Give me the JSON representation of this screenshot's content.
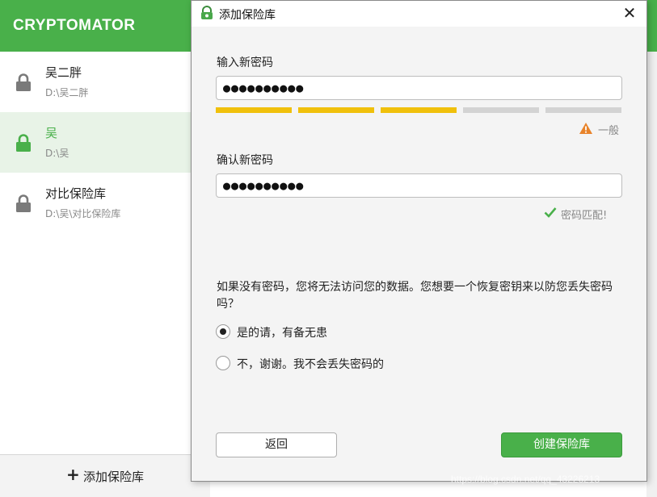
{
  "app": {
    "title": "CRYPTOMATOR"
  },
  "vaults": [
    {
      "name": "吴二胖",
      "path": "D:\\吴二胖"
    },
    {
      "name": "吴",
      "path": "D:\\吴"
    },
    {
      "name": "对比保险库",
      "path": "D:\\吴\\对比保险库"
    }
  ],
  "sidebar": {
    "add_vault_label": "添加保险库",
    "add_vault_icon": "+"
  },
  "dialog": {
    "title": "添加保险库",
    "close_glyph": "✕",
    "new_password_label": "输入新密码",
    "new_password_value": "●●●●●●●●●●",
    "strength": {
      "segments_filled": 3,
      "segments_total": 5,
      "label": "一般"
    },
    "confirm_password_label": "确认新密码",
    "confirm_password_value": "●●●●●●●●●●",
    "match_label": "密码匹配!",
    "recovery_question": "如果没有密码，您将无法访问您的数据。您想要一个恢复密钥来以防您丢失密码吗？",
    "options": [
      {
        "label": "是的请，有备无患",
        "checked": true
      },
      {
        "label": "不，谢谢。我不会丢失密码的",
        "checked": false
      }
    ],
    "back_button": "返回",
    "create_button": "创建保险库"
  },
  "watermark": "https://blog.csdn.net/qq_43226213",
  "colors": {
    "brand_green": "#49b04a",
    "strength_yellow": "#f0c00b",
    "warning_orange": "#e8832a",
    "selected_bg": "#e8f3e7"
  },
  "icons": {
    "lock": "lock-icon",
    "warning": "warning-icon",
    "check": "check-icon",
    "app": "cryptomator-app-icon",
    "close": "close-icon",
    "plus": "plus-icon"
  }
}
